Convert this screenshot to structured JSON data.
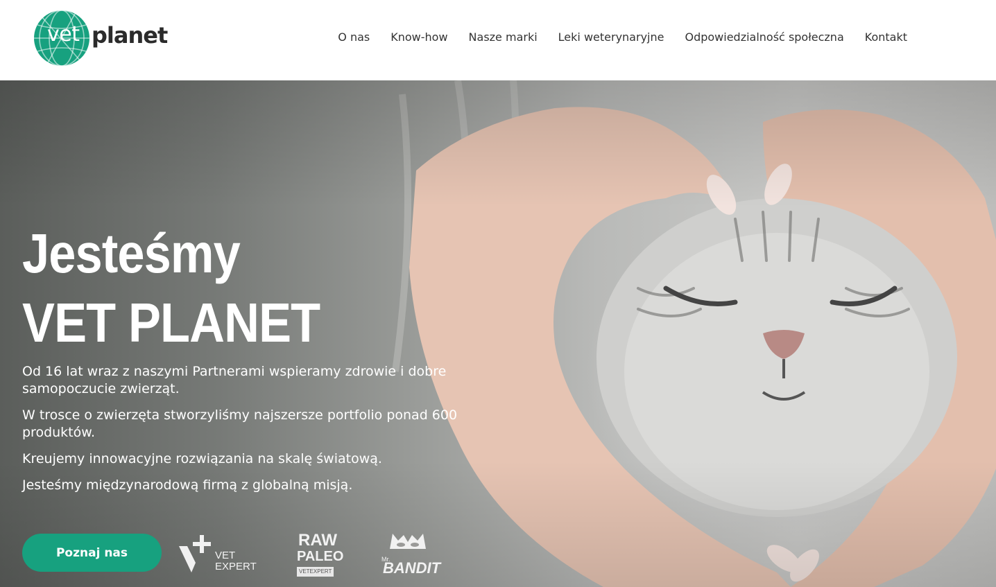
{
  "header": {
    "logo": {
      "part1": "vet",
      "part2": "planet",
      "brand_color": "#17a17f"
    },
    "nav": [
      {
        "label": "O nas"
      },
      {
        "label": "Know-how"
      },
      {
        "label": "Nasze marki"
      },
      {
        "label": "Leki weterynaryjne"
      },
      {
        "label": "Odpowiedzialność społeczna"
      },
      {
        "label": "Kontakt"
      }
    ]
  },
  "hero": {
    "headline_line1": "Jesteśmy",
    "headline_line2": "VET PLANET",
    "paragraphs": [
      "Od 16 lat wraz z naszymi Partnerami wspieramy zdrowie i dobre samopoczucie zwierząt.",
      "W trosce o zwierzęta stworzyliśmy najszersze portfolio ponad 600 produktów.",
      "Kreujemy innowacyjne rozwiązania na skalę światową.",
      "Jesteśmy międzynarodową firmą z globalną misją."
    ],
    "cta_label": "Poznaj nas",
    "cta_color": "#17a17f",
    "image_icon": "cat-heart-hands-photo",
    "brands": [
      {
        "name_line1": "VET",
        "name_line2": "EXPERT",
        "icon": "vet-expert-logo"
      },
      {
        "name_line1": "RAW",
        "name_line2": "PALEO",
        "tag": "VETEXPERT",
        "icon": "raw-paleo-logo"
      },
      {
        "name_line1": "Mr.",
        "name_line2": "BANDIT",
        "icon": "mr-bandit-logo"
      }
    ]
  }
}
